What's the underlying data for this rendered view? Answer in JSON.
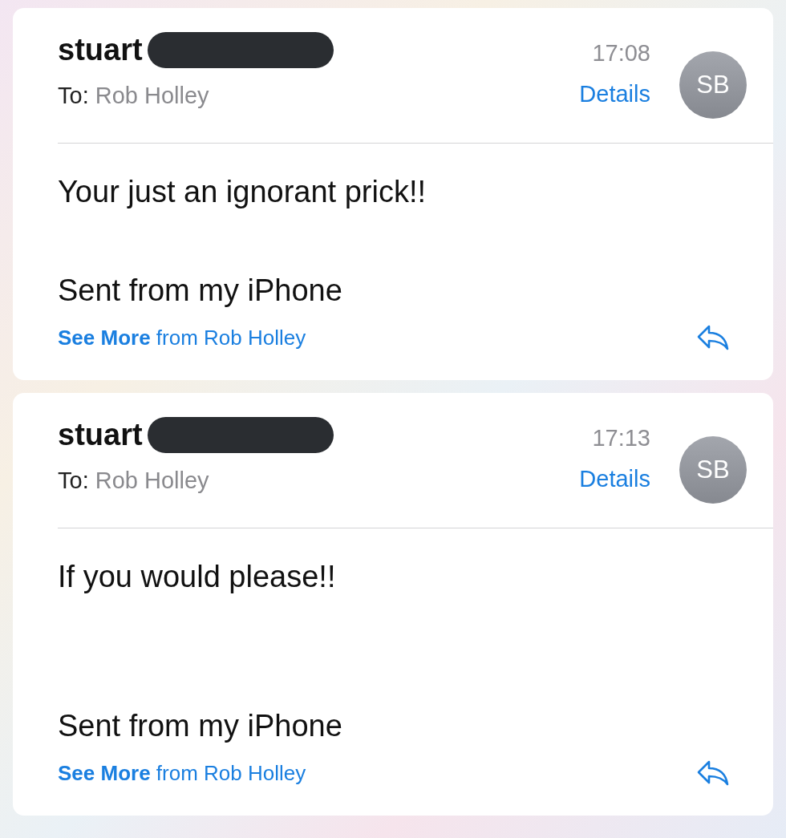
{
  "messages": [
    {
      "sender": "stuart",
      "redacted": true,
      "to_label": "To:",
      "recipient": "Rob Holley",
      "time": "17:08",
      "details": "Details",
      "initials": "SB",
      "message": "Your just an ignorant prick!!",
      "signature": "Sent from my iPhone",
      "footer": "**See More** from Rob Holley"
    },
    {
      "sender": "stuart",
      "redacted": true,
      "to_label": "To:",
      "recipient": "Rob Holley",
      "time": "17:13",
      "details": "Details",
      "initials": "SB",
      "message": "If you would please!!",
      "signature": "Sent from my iPhone",
      "footer": "**See More** from Rob Holley"
    }
  ]
}
